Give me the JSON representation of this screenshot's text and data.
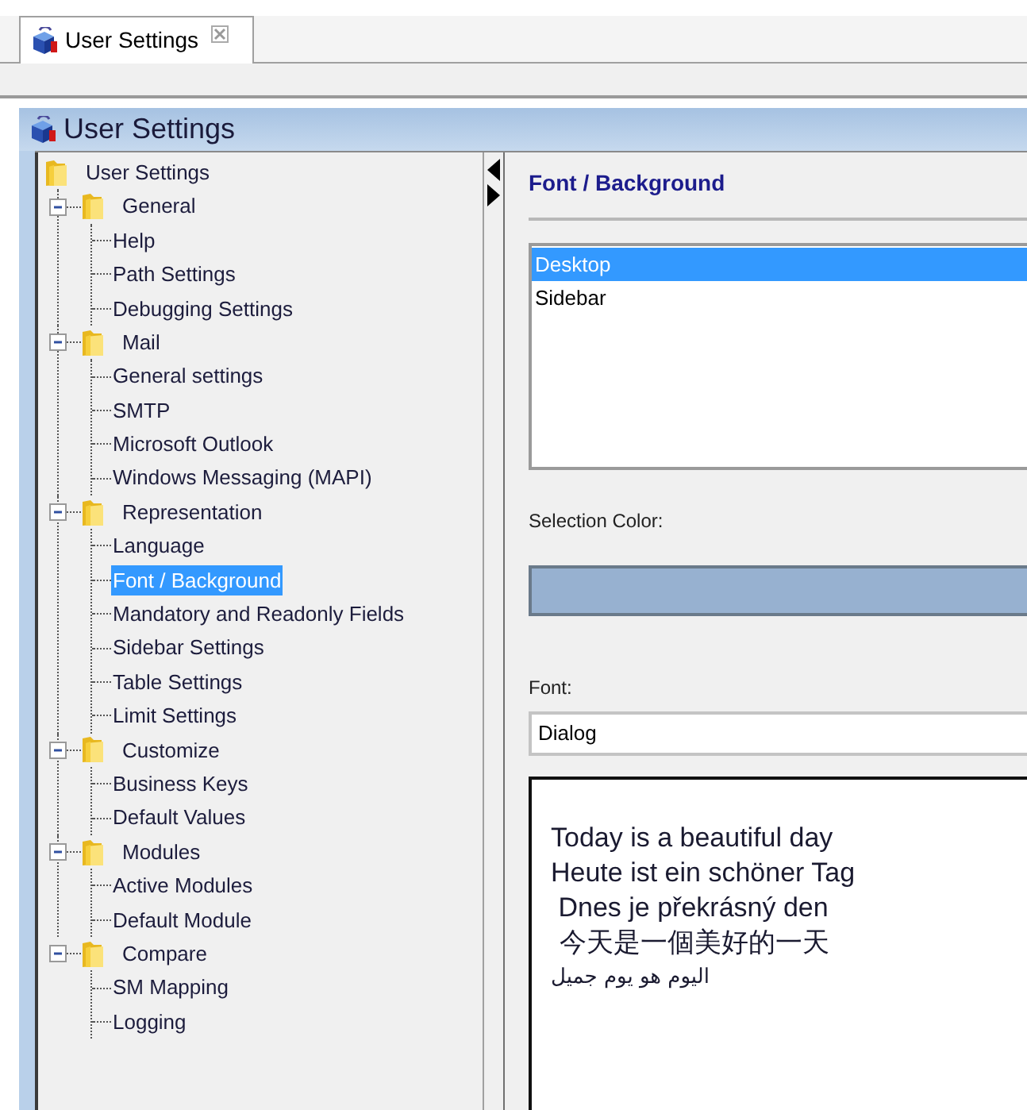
{
  "tabs": [
    {
      "label": "User Settings",
      "selected": true
    }
  ],
  "panel": {
    "title": "User Settings"
  },
  "tree": {
    "label": "User Settings",
    "selected": false,
    "children": [
      {
        "label": "General",
        "expanded": true,
        "selected": false,
        "children": [
          {
            "label": "Help",
            "selected": false
          },
          {
            "label": "Path Settings",
            "selected": false
          },
          {
            "label": "Debugging Settings",
            "selected": false
          }
        ]
      },
      {
        "label": "Mail",
        "expanded": true,
        "selected": false,
        "children": [
          {
            "label": "General settings",
            "selected": false
          },
          {
            "label": "SMTP",
            "selected": false
          },
          {
            "label": "Microsoft Outlook",
            "selected": false
          },
          {
            "label": "Windows Messaging (MAPI)",
            "selected": false
          }
        ]
      },
      {
        "label": "Representation",
        "expanded": true,
        "selected": false,
        "children": [
          {
            "label": "Language",
            "selected": false
          },
          {
            "label": "Font / Background",
            "selected": true
          },
          {
            "label": "Mandatory and Readonly Fields",
            "selected": false
          },
          {
            "label": "Sidebar Settings",
            "selected": false
          },
          {
            "label": "Table Settings",
            "selected": false
          },
          {
            "label": "Limit Settings",
            "selected": false
          }
        ]
      },
      {
        "label": "Customize",
        "expanded": true,
        "selected": false,
        "children": [
          {
            "label": "Business Keys",
            "selected": false
          },
          {
            "label": "Default Values",
            "selected": false
          }
        ]
      },
      {
        "label": "Modules",
        "expanded": true,
        "selected": false,
        "children": [
          {
            "label": "Active Modules",
            "selected": false
          },
          {
            "label": "Default Module",
            "selected": false
          }
        ]
      },
      {
        "label": "Compare",
        "expanded": true,
        "selected": false,
        "children": [
          {
            "label": "SM Mapping",
            "selected": false
          },
          {
            "label": "Logging",
            "selected": false
          }
        ]
      }
    ]
  },
  "section": {
    "title": "Font / Background"
  },
  "targets": [
    {
      "label": "Desktop",
      "selected": true
    },
    {
      "label": "Sidebar",
      "selected": false
    }
  ],
  "selection_color": {
    "label": "Selection Color:",
    "color": "#97b1d0"
  },
  "font": {
    "label": "Font:",
    "value": "Dialog"
  },
  "preview": [
    {
      "text": "Today is a beautiful day",
      "kind": "latin"
    },
    {
      "text": "Heute ist ein schöner Tag",
      "kind": "latin"
    },
    {
      "text": " Dnes je překrásný den",
      "kind": "latin"
    },
    {
      "text": " 今天是一個美好的一天",
      "kind": "cjk"
    },
    {
      "text": "اليوم هو يوم جميل",
      "kind": "arabic"
    }
  ]
}
